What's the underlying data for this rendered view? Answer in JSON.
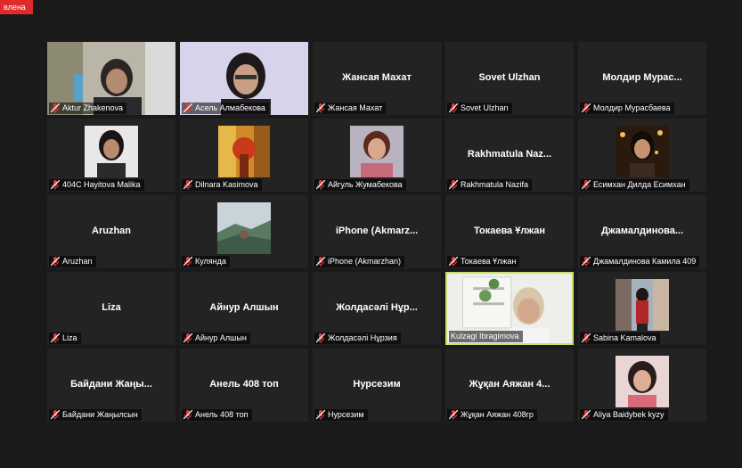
{
  "recording_badge": "влена",
  "accent": "#c8e06a",
  "participants": [
    {
      "display": "Aktur Zhakenova",
      "center": ""
    },
    {
      "display": "Асель Алмабекова",
      "center": ""
    },
    {
      "display": "Жансая Махат",
      "center": "Жансая Махат"
    },
    {
      "display": "Sovet Ulzhan",
      "center": "Sovet Ulzhan"
    },
    {
      "display": "Молдир Мурасбаева",
      "center": "Молдир  Мурас..."
    },
    {
      "display": "404C Hayitova Malika",
      "center": ""
    },
    {
      "display": "Dilnara Kasimova",
      "center": ""
    },
    {
      "display": "Айгуль Жумабекова",
      "center": ""
    },
    {
      "display": "Rakhmatula Nazifa",
      "center": "Rakhmatula  Naz..."
    },
    {
      "display": "Есимхан Дилда Есимхан",
      "center": ""
    },
    {
      "display": "Aruzhan",
      "center": "Aruzhan"
    },
    {
      "display": "Кулянда",
      "center": ""
    },
    {
      "display": "iPhone (Akmarzhan)",
      "center": "iPhone  (Akmarz..."
    },
    {
      "display": "Токаева Ұлжан",
      "center": "Токаева Ұлжан"
    },
    {
      "display": "Джамалдинова Камила 409",
      "center": "Джамалдинова..."
    },
    {
      "display": "Liza",
      "center": "Liza"
    },
    {
      "display": "Айнур Алшын",
      "center": "Айнур Алшын"
    },
    {
      "display": "Жолдасәлі Нұрзия",
      "center": "Жолдасәлі Нұр..."
    },
    {
      "display": "Kulzagi Ibragimova",
      "center": ""
    },
    {
      "display": "Sabina Kamalova",
      "center": ""
    },
    {
      "display": "Байдани Жаңылсын",
      "center": "Байдани  Жаңы..."
    },
    {
      "display": "Анель 408 топ",
      "center": "Анель 408 топ"
    },
    {
      "display": "Нурсезим",
      "center": "Нурсезим"
    },
    {
      "display": "Жұқан Аяжан 408гр",
      "center": "Жұқан Аяжан 4..."
    },
    {
      "display": "Aliya Baidybek kyzy",
      "center": ""
    }
  ]
}
